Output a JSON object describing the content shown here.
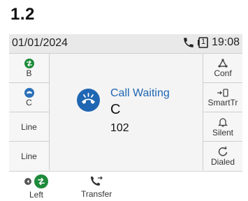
{
  "heading": "1.2",
  "status": {
    "date": "01/01/2024",
    "line_badge": "1",
    "time": "19:08"
  },
  "left_keys": [
    {
      "label": "B",
      "icon": "transfer-icon"
    },
    {
      "label": "C",
      "icon": "call-waiting-icon"
    },
    {
      "label": "Line"
    },
    {
      "label": "Line"
    }
  ],
  "right_keys": [
    {
      "label": "Conf",
      "icon": "conference-icon"
    },
    {
      "label": "SmartTr",
      "icon": "smart-transfer-icon"
    },
    {
      "label": "Silent",
      "icon": "bell-icon"
    },
    {
      "label": "Dialed",
      "icon": "redial-icon"
    }
  ],
  "call": {
    "title": "Call Waiting",
    "name": "C",
    "number": "102"
  },
  "softkeys": {
    "left": "Left",
    "transfer": "Transfer"
  },
  "colors": {
    "accent_blue": "#1f66b3",
    "green": "#1e8a3a"
  }
}
